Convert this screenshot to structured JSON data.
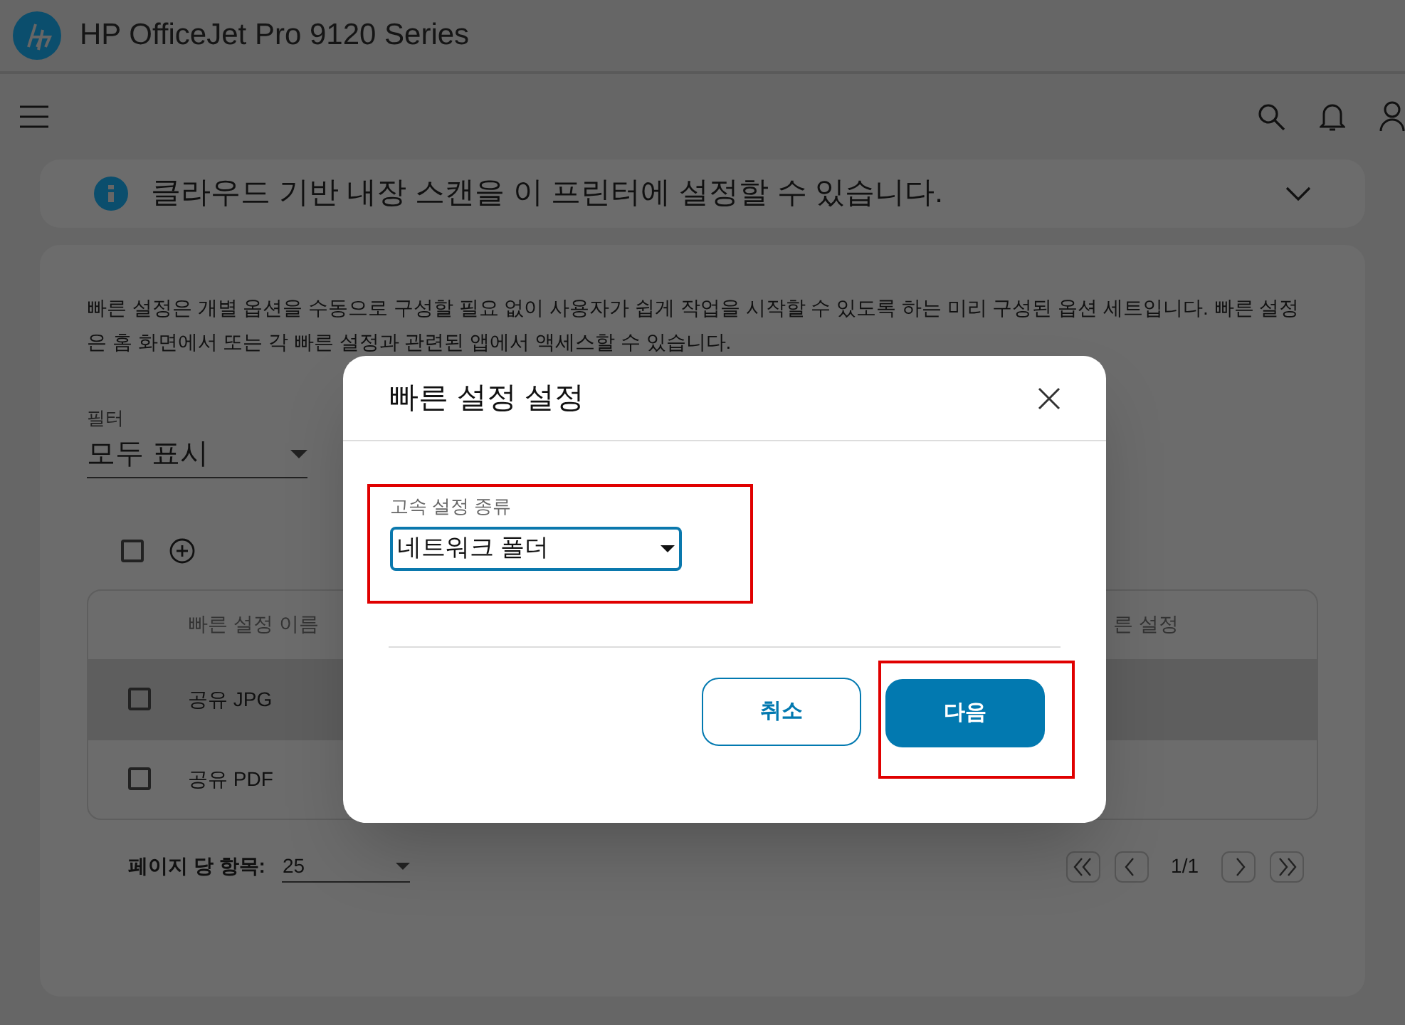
{
  "header": {
    "title": "HP OfficeJet Pro 9120 Series"
  },
  "banner": {
    "text": "클라우드 기반 내장 스캔을 이 프린터에 설정할 수 있습니다.",
    "expanded": false
  },
  "description": "빠른 설정은 개별 옵션을 수동으로 구성할 필요 없이 사용자가 쉽게 작업을 시작할 수 있도록 하는 미리 구성된 옵션 세트입니다. 빠른 설정은 홈 화면에서 또는 각 빠른 설정과 관련된 앱에서 액세스할 수 있습니다.",
  "filter": {
    "label": "필터",
    "value": "모두 표시"
  },
  "select_all": {
    "checked": false
  },
  "table": {
    "columns": [
      "빠른 설정 이름",
      "른 설정"
    ],
    "rows": [
      {
        "name": "공유 JPG",
        "checked": false,
        "selected": true
      },
      {
        "name": "공유 PDF",
        "checked": false,
        "selected": false
      }
    ]
  },
  "pagination": {
    "label": "페이지 당 항목:",
    "per_page": "25",
    "page": "1/1"
  },
  "dialog": {
    "title": "빠른 설정 설정",
    "field_label": "고속 설정 종류",
    "field_value": "네트워크 폴더",
    "buttons": [
      {
        "label": "취소",
        "kind": "secondary"
      },
      {
        "label": "다음",
        "kind": "primary"
      }
    ]
  }
}
